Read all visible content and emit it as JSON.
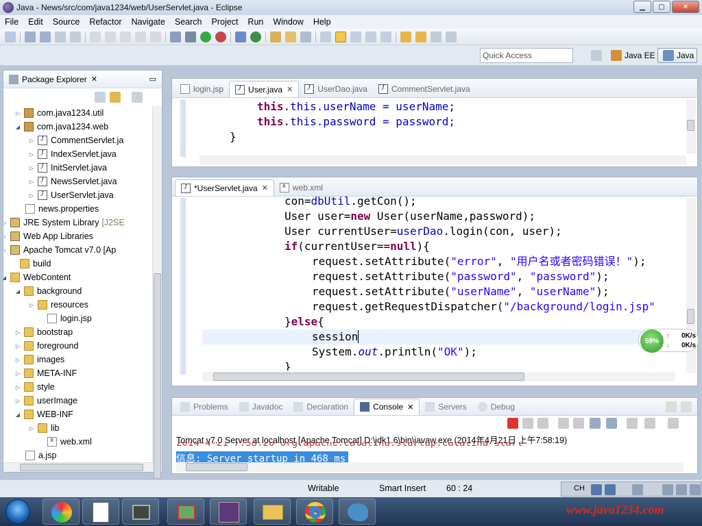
{
  "window": {
    "title": "Java - News/src/com/java1234/web/UserServlet.java - Eclipse"
  },
  "menu": [
    "File",
    "Edit",
    "Source",
    "Refactor",
    "Navigate",
    "Search",
    "Project",
    "Run",
    "Window",
    "Help"
  ],
  "quick_access": {
    "placeholder": "Quick Access"
  },
  "perspectives": {
    "javaee": "Java EE",
    "java": "Java"
  },
  "package_explorer": {
    "title": "Package Explorer",
    "tree": [
      {
        "label": "com.java1234.util",
        "icon": "package-icon"
      },
      {
        "label": "com.java1234.web",
        "icon": "package-icon"
      },
      {
        "label": "CommentServlet.ja",
        "icon": "java-file-icon"
      },
      {
        "label": "IndexServlet.java",
        "icon": "java-file-icon"
      },
      {
        "label": "InitServlet.java",
        "icon": "java-file-icon"
      },
      {
        "label": "NewsServlet.java",
        "icon": "java-file-icon"
      },
      {
        "label": "UserServlet.java",
        "icon": "java-file-icon"
      },
      {
        "label": "news.properties",
        "icon": "file-icon"
      },
      {
        "label": "JRE System Library",
        "icon": "library-icon",
        "suffix": "[J2SE"
      },
      {
        "label": "Web App Libraries",
        "icon": "library-icon"
      },
      {
        "label": "Apache Tomcat v7.0 [Ap",
        "icon": "library-icon"
      },
      {
        "label": "build",
        "icon": "folder-icon"
      },
      {
        "label": "WebContent",
        "icon": "folder-icon"
      },
      {
        "label": "background",
        "icon": "folder-icon"
      },
      {
        "label": "resources",
        "icon": "folder-icon"
      },
      {
        "label": "login.jsp",
        "icon": "file-icon"
      },
      {
        "label": "bootstrap",
        "icon": "folder-icon"
      },
      {
        "label": "foreground",
        "icon": "folder-icon"
      },
      {
        "label": "images",
        "icon": "folder-icon"
      },
      {
        "label": "META-INF",
        "icon": "folder-icon"
      },
      {
        "label": "style",
        "icon": "folder-icon"
      },
      {
        "label": "userImage",
        "icon": "folder-icon"
      },
      {
        "label": "WEB-INF",
        "icon": "folder-icon"
      },
      {
        "label": "lib",
        "icon": "folder-icon"
      },
      {
        "label": "web.xml",
        "icon": "xml-file-icon"
      },
      {
        "label": "a.jsp",
        "icon": "file-icon"
      }
    ]
  },
  "editor_top": {
    "tabs": [
      "login.jsp",
      "User.java",
      "UserDao.java",
      "CommentServlet.java"
    ],
    "active_tab": "User.java",
    "lines": [
      "this.userName = userName;",
      "this.password = password;",
      "}"
    ]
  },
  "editor_main": {
    "tabs": [
      "*UserServlet.java",
      "web.xml"
    ],
    "active_tab": "*UserServlet.java",
    "lines": [
      "con=dbUtil.getCon();",
      "User user=new User(userName,password);",
      "User currentUser=userDao.login(con, user);",
      "if(currentUser==null){",
      "request.setAttribute(\"error\", \"用户名或者密码错误！\");",
      "request.setAttribute(\"password\", \"password\");",
      "request.setAttribute(\"userName\", \"userName\");",
      "request.getRequestDispatcher(\"/background/login.jsp\"",
      "}else{",
      "session",
      "System.out.println(\"OK\");",
      "}"
    ]
  },
  "console": {
    "tabs": [
      "Problems",
      "Javadoc",
      "Declaration",
      "Console",
      "Servers",
      "Debug"
    ],
    "active_tab": "Console",
    "header": "Tomcat v7.0 Server at localhost [Apache Tomcat] D:\\jdk1.6\\bin\\javaw.exe (2014年4月21日 上午7:58:19)",
    "line1": "2014-4-21 7:58:20 org.apache.catalina.startup.Catalina start",
    "line2": "信息: Server startup in 468 ms"
  },
  "status": {
    "writable": "Writable",
    "insert_mode": "Smart Insert",
    "position": "60 : 24"
  },
  "net_widget": {
    "percent": "59%",
    "up": "0K/s",
    "down": "0K/s"
  },
  "tray": {
    "ime": "CH"
  },
  "watermark": "www.java1234.com",
  "colors": {
    "keyword": "#7f0055",
    "field": "#0000c0",
    "string": "#2a00ff",
    "watermark": "#e0271f"
  }
}
